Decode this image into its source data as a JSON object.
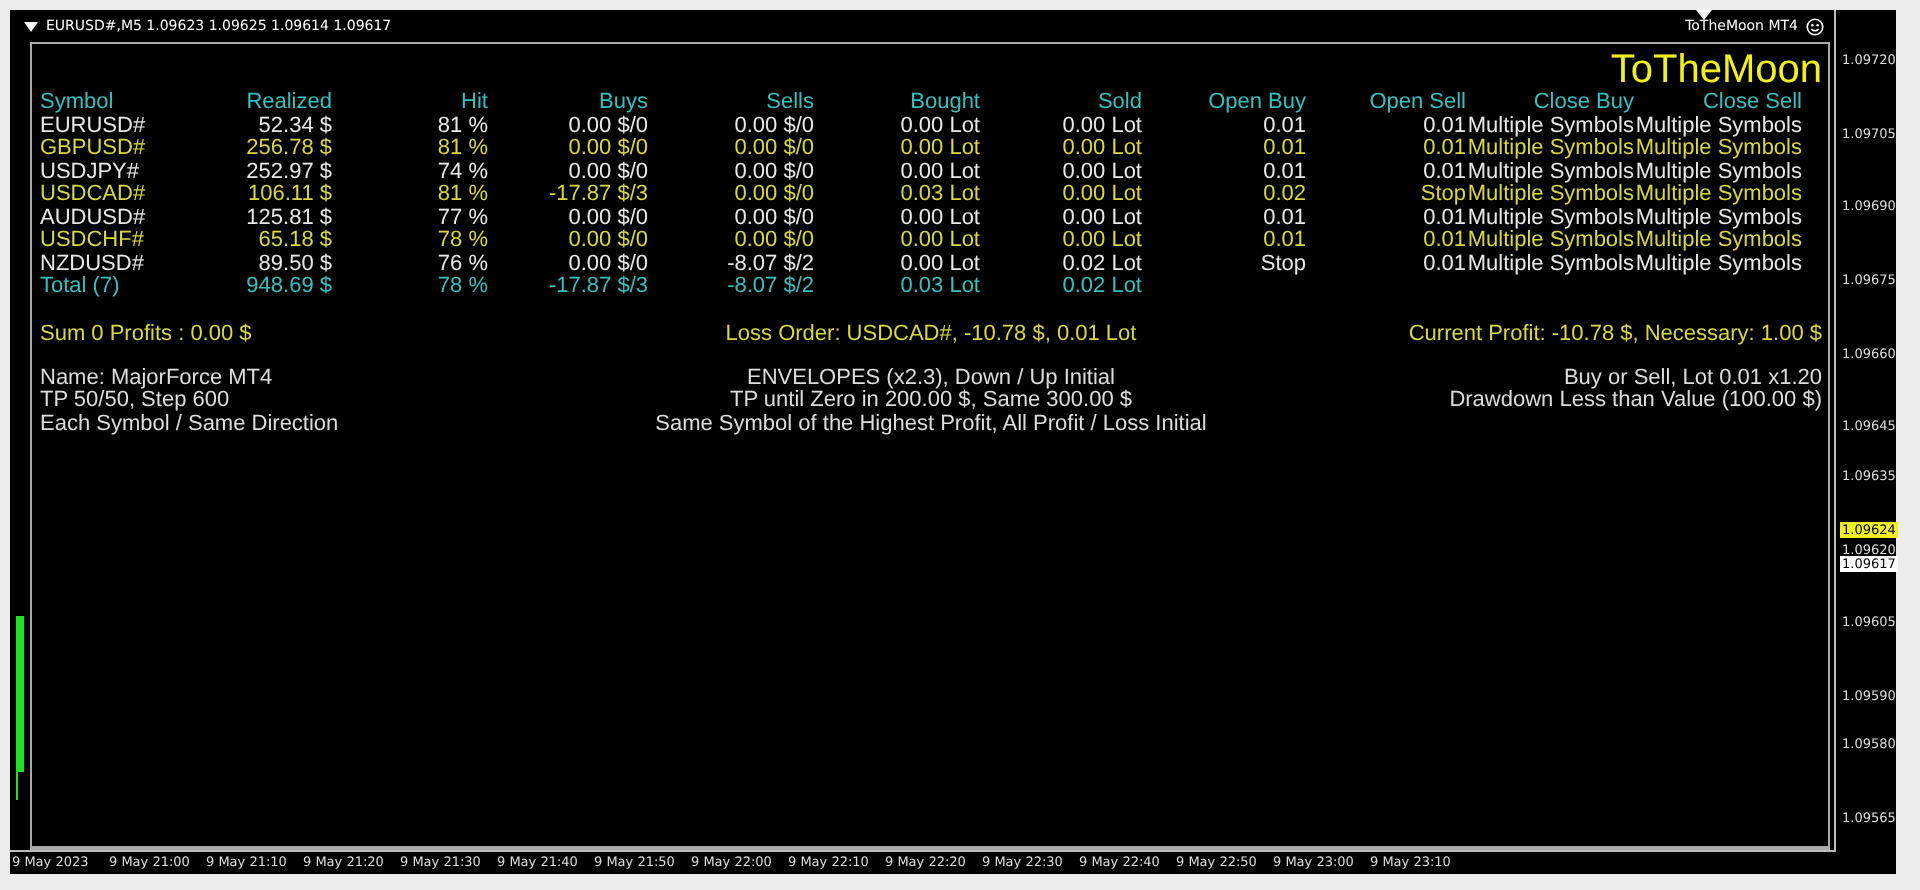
{
  "title_bar": {
    "symbol_info": "EURUSD#,M5  1.09623 1.09625 1.09614 1.09617",
    "expert": "ToTheMoon MT4"
  },
  "panel": {
    "heading": "ToTheMoon",
    "table": {
      "columns": [
        "Symbol",
        "Realized",
        "Hit",
        "Buys",
        "Sells",
        "Bought",
        "Sold",
        "Open Buy",
        "Open Sell",
        "Close Buy",
        "Close Sell"
      ],
      "rows": [
        {
          "kind": "normal",
          "cells": [
            "EURUSD#",
            "52.34 $",
            "81 %",
            "0.00 $/0",
            "0.00 $/0",
            "0.00 Lot",
            "0.00 Lot",
            "0.01",
            "0.01",
            "Multiple Symbols",
            "Multiple Symbols"
          ]
        },
        {
          "kind": "alt",
          "cells": [
            "GBPUSD#",
            "256.78 $",
            "81 %",
            "0.00 $/0",
            "0.00 $/0",
            "0.00 Lot",
            "0.00 Lot",
            "0.01",
            "0.01",
            "Multiple Symbols",
            "Multiple Symbols"
          ]
        },
        {
          "kind": "normal",
          "cells": [
            "USDJPY#",
            "252.97 $",
            "74 %",
            "0.00 $/0",
            "0.00 $/0",
            "0.00 Lot",
            "0.00 Lot",
            "0.01",
            "0.01",
            "Multiple Symbols",
            "Multiple Symbols"
          ]
        },
        {
          "kind": "alt",
          "cells": [
            "USDCAD#",
            "106.11 $",
            "81 %",
            "-17.87 $/3",
            "0.00 $/0",
            "0.03 Lot",
            "0.00 Lot",
            "0.02",
            "Stop",
            "Multiple Symbols",
            "Multiple Symbols"
          ]
        },
        {
          "kind": "normal",
          "cells": [
            "AUDUSD#",
            "125.81 $",
            "77 %",
            "0.00 $/0",
            "0.00 $/0",
            "0.00 Lot",
            "0.00 Lot",
            "0.01",
            "0.01",
            "Multiple Symbols",
            "Multiple Symbols"
          ]
        },
        {
          "kind": "alt",
          "cells": [
            "USDCHF#",
            "65.18 $",
            "78 %",
            "0.00 $/0",
            "0.00 $/0",
            "0.00 Lot",
            "0.00 Lot",
            "0.01",
            "0.01",
            "Multiple Symbols",
            "Multiple Symbols"
          ]
        },
        {
          "kind": "normal",
          "cells": [
            "NZDUSD#",
            "89.50 $",
            "76 %",
            "0.00 $/0",
            "-8.07 $/2",
            "0.00 Lot",
            "0.02 Lot",
            "Stop",
            "0.01",
            "Multiple Symbols",
            "Multiple Symbols"
          ]
        },
        {
          "kind": "total",
          "cells": [
            "Total (7)",
            "948.69 $",
            "78 %",
            "-17.87 $/3",
            "-8.07 $/2",
            "0.03 Lot",
            "0.02 Lot"
          ]
        }
      ]
    },
    "summary": {
      "left": "Sum 0 Profits : 0.00 $",
      "center": "Loss Order: USDCAD#, -10.78 $, 0.01 Lot",
      "right": "Current Profit: -10.78 $, Necessary: 1.00 $"
    },
    "info": {
      "left": [
        "Name: MajorForce MT4",
        "TP 50/50, Step 600",
        "Each Symbol / Same Direction"
      ],
      "center": [
        "ENVELOPES (x2.3), Down / Up Initial",
        "TP until Zero in 200.00 $, Same 300.00 $",
        "Same Symbol of the Highest Profit, All Profit / Loss Initial"
      ],
      "right": [
        "Buy or Sell, Lot 0.01 x1.20",
        "Drawdown Less than Value (100.00 $)"
      ]
    }
  },
  "price_axis": [
    {
      "kind": "tick",
      "label": "1.09720"
    },
    {
      "kind": "tick",
      "label": "1.09705"
    },
    {
      "kind": "tick",
      "label": "1.09690"
    },
    {
      "kind": "tick",
      "label": "1.09675"
    },
    {
      "kind": "tick",
      "label": "1.09660"
    },
    {
      "kind": "tick",
      "label": "1.09645"
    },
    {
      "kind": "tick",
      "label": "1.09635"
    },
    {
      "kind": "bid",
      "label": "1.09624"
    },
    {
      "kind": "tick",
      "label": "1.09620"
    },
    {
      "kind": "last",
      "label": "1.09617"
    },
    {
      "kind": "tick",
      "label": "1.09605"
    },
    {
      "kind": "tick",
      "label": "1.09590"
    },
    {
      "kind": "tick",
      "label": "1.09580"
    },
    {
      "kind": "tick",
      "label": "1.09565"
    }
  ],
  "time_axis": [
    "9 May 2023",
    "9 May 21:00",
    "9 May 21:10",
    "9 May 21:20",
    "9 May 21:30",
    "9 May 21:40",
    "9 May 21:50",
    "9 May 22:00",
    "9 May 22:10",
    "9 May 22:20",
    "9 May 22:30",
    "9 May 22:40",
    "9 May 22:50",
    "9 May 23:00",
    "9 May 23:10"
  ]
}
